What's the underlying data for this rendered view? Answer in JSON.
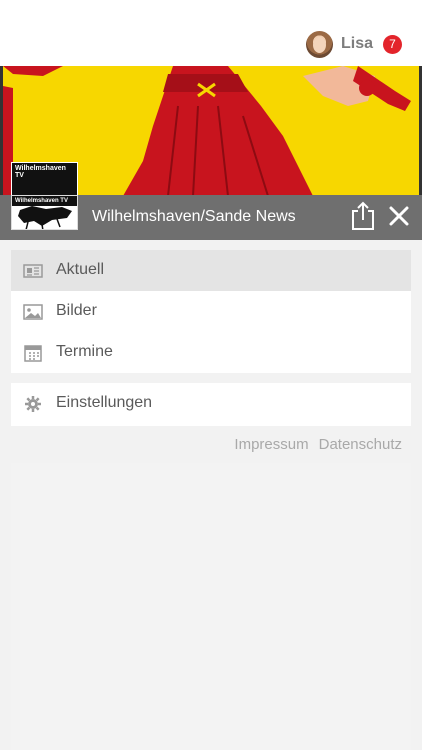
{
  "user": {
    "name": "Lisa",
    "notification_count": "7"
  },
  "banner": {
    "colors": {
      "yellow": "#f7d700",
      "red": "#c8141e",
      "header": "#6f6f6f"
    }
  },
  "channel": {
    "title": "Wilhelmshaven/Sande News",
    "logo_text": "Wilhelmshaven TV"
  },
  "menu": {
    "items": [
      {
        "label": "Aktuell",
        "icon": "newspaper-icon",
        "active": true
      },
      {
        "label": "Bilder",
        "icon": "image-icon",
        "active": false
      },
      {
        "label": "Termine",
        "icon": "calendar-icon",
        "active": false
      }
    ],
    "settings": {
      "label": "Einstellungen",
      "icon": "gear-icon"
    }
  },
  "footer": {
    "impressum": "Impressum",
    "datenschutz": "Datenschutz"
  }
}
